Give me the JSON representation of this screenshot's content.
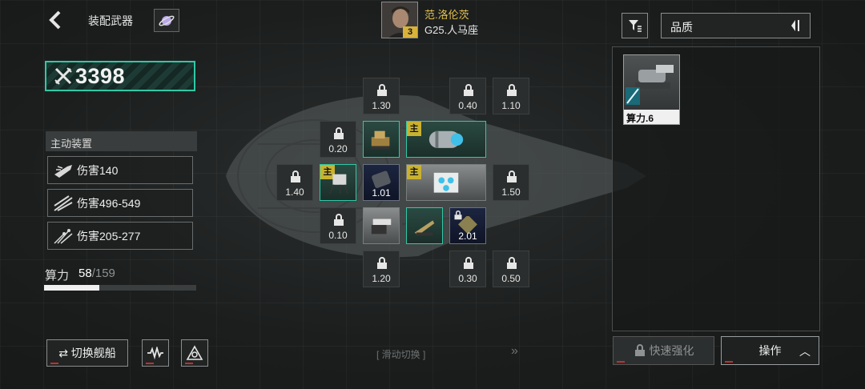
{
  "header": {
    "title": "装配武器",
    "back_icon": "back-arrow-icon",
    "planet_icon": "planet-icon"
  },
  "power": {
    "value": "3398"
  },
  "active_devices": {
    "title": "主动装置",
    "items": [
      {
        "label": "伤害140",
        "icon": "missile-icon"
      },
      {
        "label": "伤害496-549",
        "icon": "laser-icon"
      },
      {
        "label": "伤害205-277",
        "icon": "scatter-icon"
      }
    ]
  },
  "compute": {
    "label": "算力",
    "used": "58",
    "sep": "/",
    "total": "159",
    "fill_fraction": 0.365
  },
  "bottom": {
    "switch_ship": "⇄ 切换舰船",
    "slide_hint": "[ 滑动切换 ]",
    "slide_arrow": "»"
  },
  "pilot": {
    "name": "范.洛伦茨",
    "ship": "G25.人马座",
    "level": "3"
  },
  "filter": {
    "quality_label": "品质",
    "sort_icon": "sort-toggle-icon"
  },
  "inventory": {
    "items": [
      {
        "label": "算力.6"
      }
    ]
  },
  "actions": {
    "quick_upgrade": "快速强化",
    "operate": "操作"
  },
  "slots": {
    "locked": [
      "1.30",
      "0.40",
      "1.10",
      "0.20",
      "1.40",
      "1.50",
      "0.10",
      "1.20",
      "0.30",
      "0.50"
    ],
    "equipped": [
      {
        "main": "",
        "value": ""
      },
      {
        "main": "主",
        "value": ""
      },
      {
        "main": "主",
        "value": ""
      },
      {
        "main": "",
        "value": "1.01"
      },
      {
        "main": "主",
        "value": ""
      },
      {
        "main": "",
        "value": ""
      },
      {
        "main": "",
        "value": ""
      },
      {
        "main": "",
        "value": "2.01"
      }
    ]
  },
  "colors": {
    "accent": "#2fc9a6",
    "gold": "#e4c24d",
    "main_tag": "#c9b230"
  }
}
